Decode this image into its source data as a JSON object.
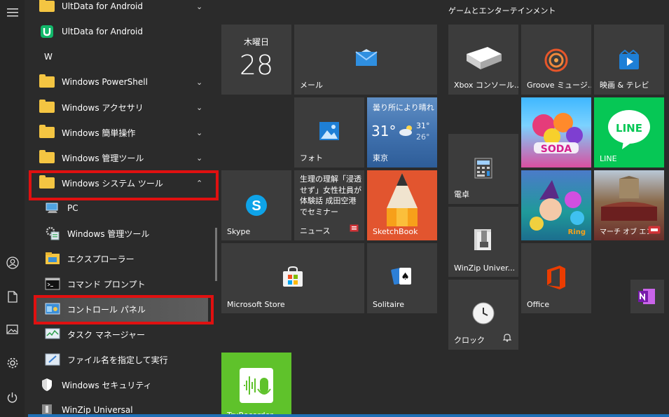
{
  "apps": {
    "ultdata_folder": "UltData for Android",
    "ultdata_app": "UltData for Android",
    "section_w": "W",
    "powershell": "Windows PowerShell",
    "accessories": "Windows アクセサリ",
    "ease": "Windows 簡単操作",
    "admin_tools": "Windows 管理ツール",
    "system_tools": "Windows システム ツール",
    "pc": "PC",
    "sub_admin_tools": "Windows 管理ツール",
    "explorer": "エクスプローラー",
    "cmd": "コマンド プロンプト",
    "control_panel": "コントロール パネル",
    "task_manager": "タスク マネージャー",
    "run": "ファイル名を指定して実行",
    "security": "Windows セキュリティ",
    "winzip": "WinZip Universal"
  },
  "tiles": {
    "calendar_day": "木曜日",
    "calendar_date": "28",
    "mail": "メール",
    "photos": "フォト",
    "weather_desc": "曇り所により晴れ",
    "weather_temp": "31°",
    "weather_high": "31°",
    "weather_low": "26°",
    "weather_city": "東京",
    "skype": "Skype",
    "news_headline": "生理の理解「浸透せず」女性社員が体験話 成田空港でセミナー",
    "news": "ニュース",
    "sketchbook": "SketchBook",
    "store": "Microsoft Store",
    "solitaire": "Solitaire",
    "trurecorder": "TruRecorder"
  },
  "group2": {
    "title": "ゲームとエンターテインメント",
    "xbox": "Xbox コンソール...",
    "groove": "Groove ミュージ...",
    "movies": "映画 & テレビ",
    "line": "LINE",
    "line_logo": "LINE",
    "candy_logo": "SODA",
    "calculator": "電卓",
    "winzip": "WinZip Univer...",
    "clock": "クロック",
    "office": "Office",
    "bubble_logo": "Ring",
    "march": "マーチ オブ エン"
  },
  "colors": {
    "accent": "#0078d7",
    "highlight_red": "#e01010",
    "line_green": "#06c755",
    "tile_bg": "#3c3c3c"
  }
}
